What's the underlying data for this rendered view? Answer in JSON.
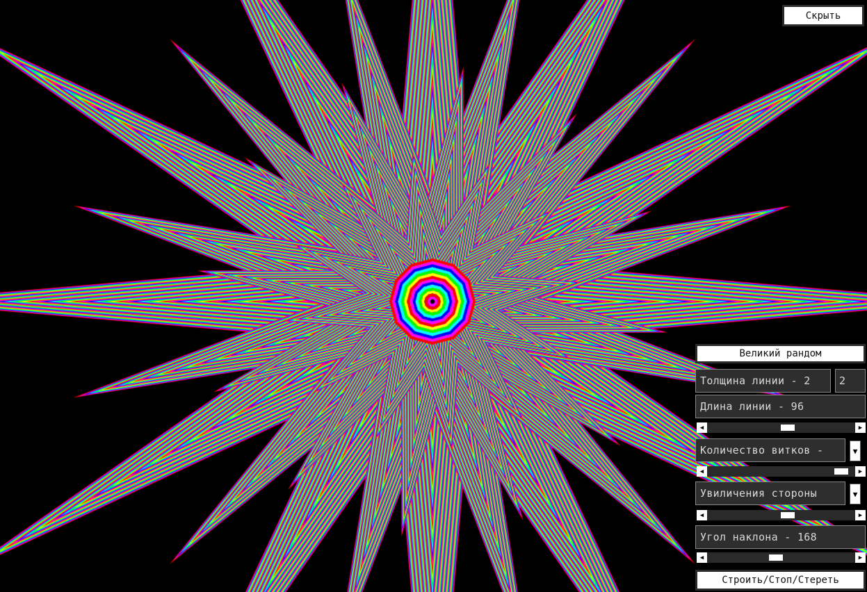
{
  "hide_button": {
    "label": "Скрыть"
  },
  "panel": {
    "random_button": "Великий рандом",
    "line_thickness": {
      "label": "Толщина линии - 2",
      "value": "2"
    },
    "line_length": {
      "label": "Длина линии - 96",
      "slider_fraction": 0.55
    },
    "turns_count": {
      "label": "Количество витков -",
      "dropdown_icon": "chevron-down-icon",
      "slider_fraction": 0.95
    },
    "side_increase": {
      "label": "Увиличения стороны",
      "dropdown_icon": "chevron-down-icon",
      "slider_fraction": 0.55
    },
    "tilt_angle": {
      "label": "Угол наклона - 168",
      "slider_fraction": 0.46
    },
    "build_button": "Строить/Стоп/Стереть"
  },
  "art": {
    "points": 12,
    "palette": [
      "#ff0000",
      "#ff00ff",
      "#0000ff",
      "#00ffff",
      "#00ff00",
      "#ffff00"
    ]
  }
}
